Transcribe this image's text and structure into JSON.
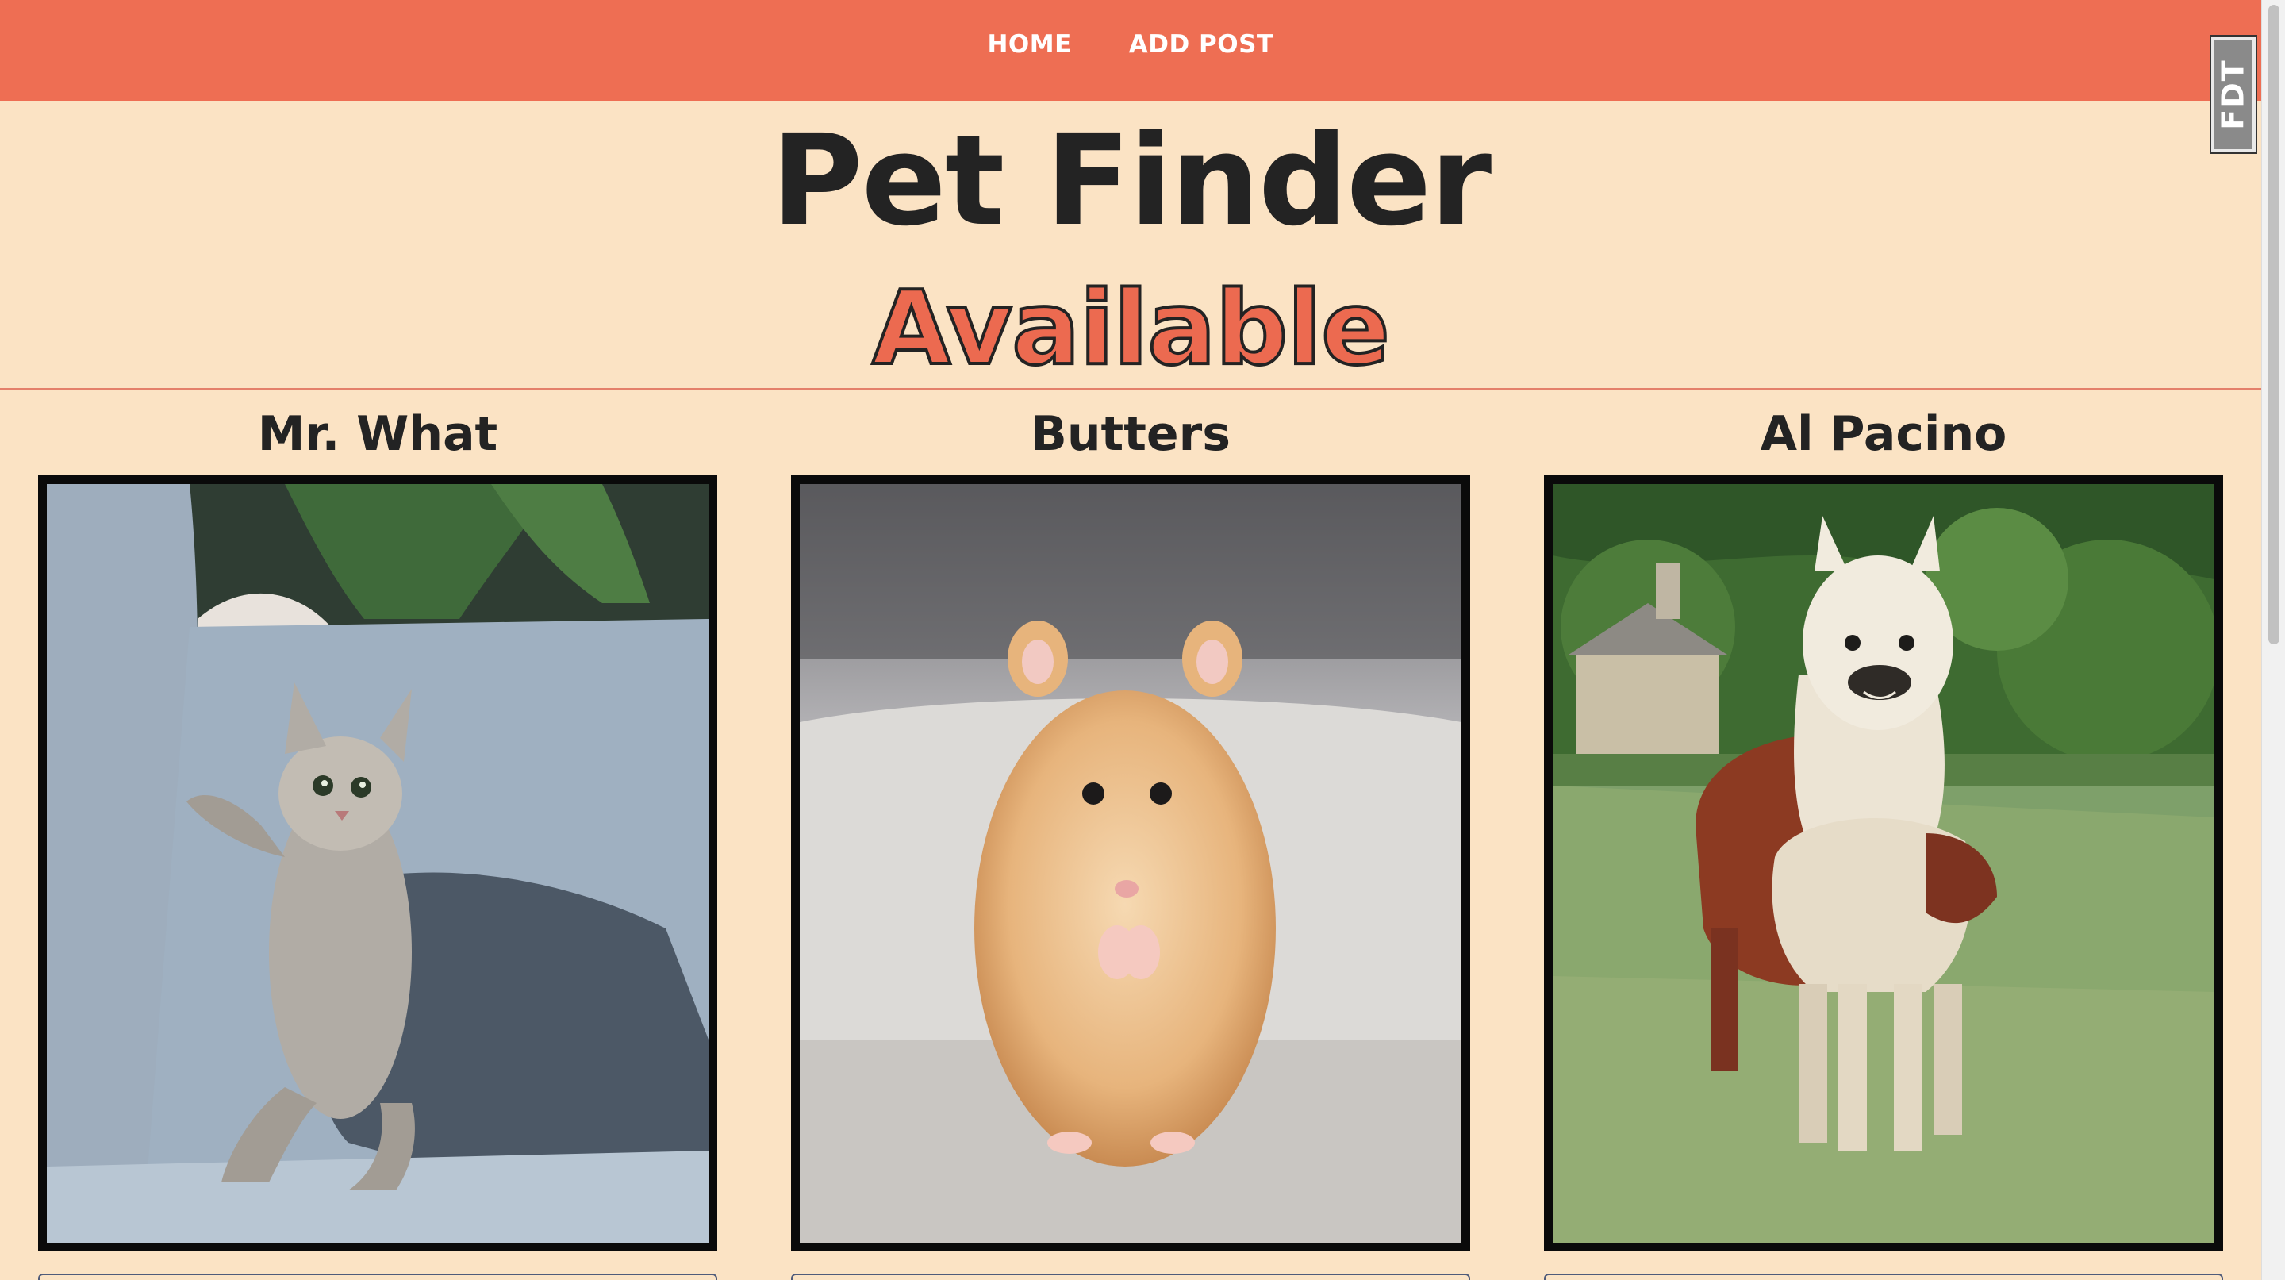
{
  "nav": {
    "links": [
      "HOME",
      "ADD POST"
    ]
  },
  "header": {
    "title": "Pet Finder",
    "section_title": "Available"
  },
  "pets": [
    {
      "name": "Mr. What",
      "photo_icon": "kitten-photo"
    },
    {
      "name": "Butters",
      "photo_icon": "hamster-photo"
    },
    {
      "name": "Al Pacino",
      "photo_icon": "alpaca-photo"
    }
  ],
  "badge": {
    "label": "FDT"
  },
  "colors": {
    "navbar": "#ee6e53",
    "background": "#fbe3c4",
    "title_text": "#232323",
    "accent": "#ec6a50"
  }
}
